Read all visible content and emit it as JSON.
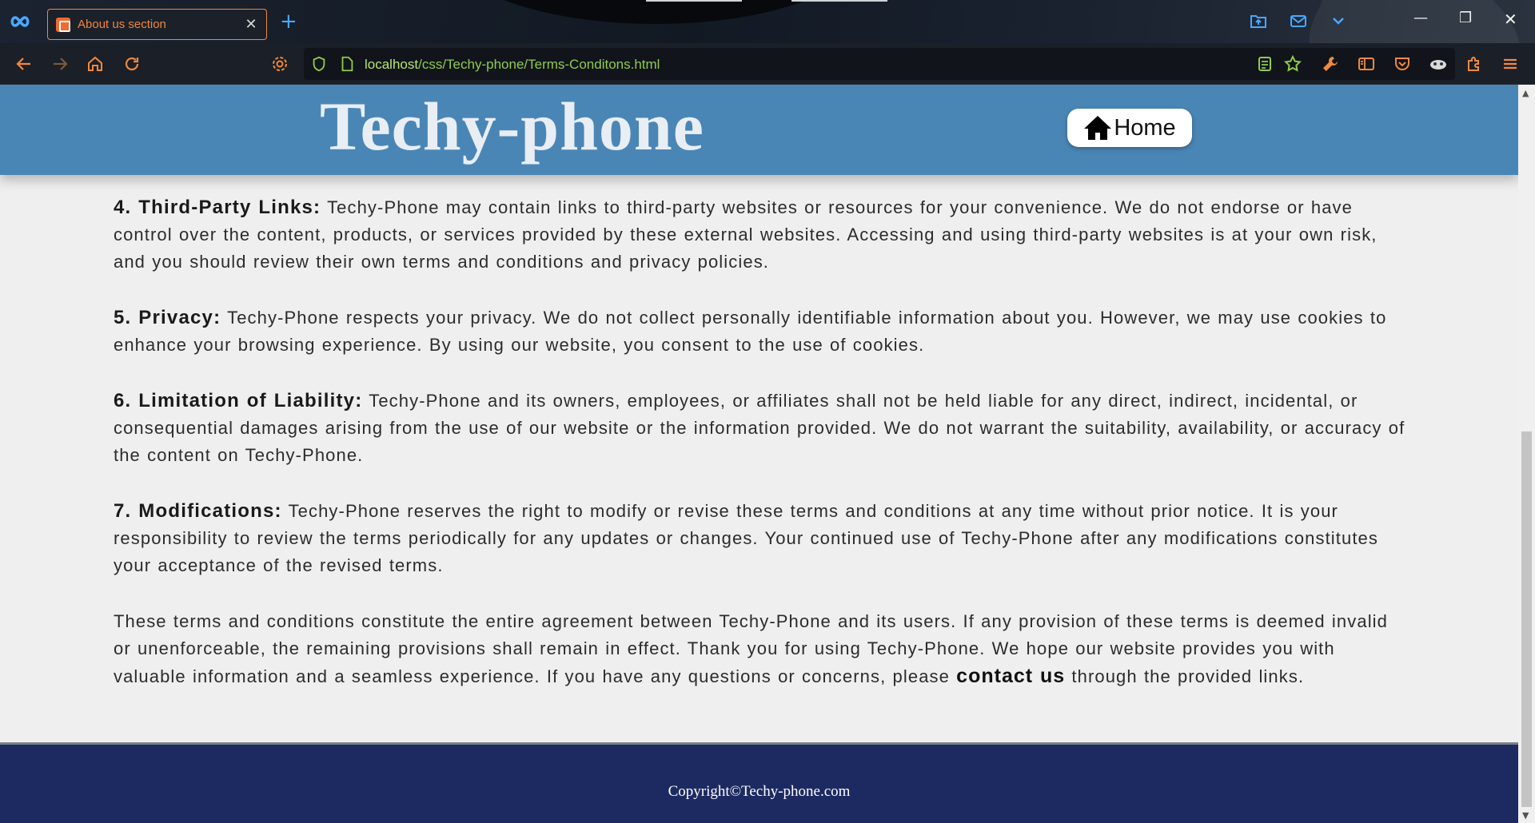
{
  "browser": {
    "tab_title": "About us section",
    "url_host": "localhost",
    "url_path": "/css/Techy-phone/Terms-Conditons.html"
  },
  "site": {
    "title": "Techy-phone",
    "home_label": "Home"
  },
  "sections": [
    {
      "heading": "4. Third-Party Links:",
      "body": " Techy-Phone may contain links to third-party websites or resources for your convenience. We do not endorse or have control over the content, products, or services provided by these external websites. Accessing and using third-party websites is at your own risk, and you should review their own terms and conditions and privacy policies."
    },
    {
      "heading": "5. Privacy:",
      "body": " Techy-Phone respects your privacy. We do not collect personally identifiable information about you. However, we may use cookies to enhance your browsing experience. By using our website, you consent to the use of cookies."
    },
    {
      "heading": "6. Limitation of Liability:",
      "body": " Techy-Phone and its owners, employees, or affiliates shall not be held liable for any direct, indirect, incidental, or consequential damages arising from the use of our website or the information provided. We do not warrant the suitability, availability, or accuracy of the content on Techy-Phone."
    },
    {
      "heading": "7. Modifications:",
      "body": " Techy-Phone reserves the right to modify or revise these terms and conditions at any time without prior notice. It is your responsibility to review the terms periodically for any updates or changes. Your continued use of Techy-Phone after any modifications constitutes your acceptance of the revised terms."
    }
  ],
  "closing": {
    "text_before": "These terms and conditions constitute the entire agreement between Techy-Phone and its users. If any provision of these terms is deemed invalid or unenforceable, the remaining provisions shall remain in effect. Thank you for using Techy-Phone. We hope our website provides you with valuable information and a seamless experience. If you have any questions or concerns, please ",
    "link_text": "contact us",
    "text_after": " through the provided links."
  },
  "footer": {
    "copyright": "Copyright©Techy-phone.com"
  },
  "colors": {
    "header_bg": "#4a86b5",
    "footer_bg": "#1d2a62",
    "tab_accent": "#f08a3c",
    "url_green": "#8fcb4d"
  },
  "icons": {
    "app": "infinity-icon",
    "back": "back-arrow-icon",
    "forward": "forward-arrow-icon",
    "home": "house-icon",
    "reload": "reload-icon",
    "settings": "gear-icon",
    "shield": "shield-icon",
    "page": "page-icon"
  }
}
